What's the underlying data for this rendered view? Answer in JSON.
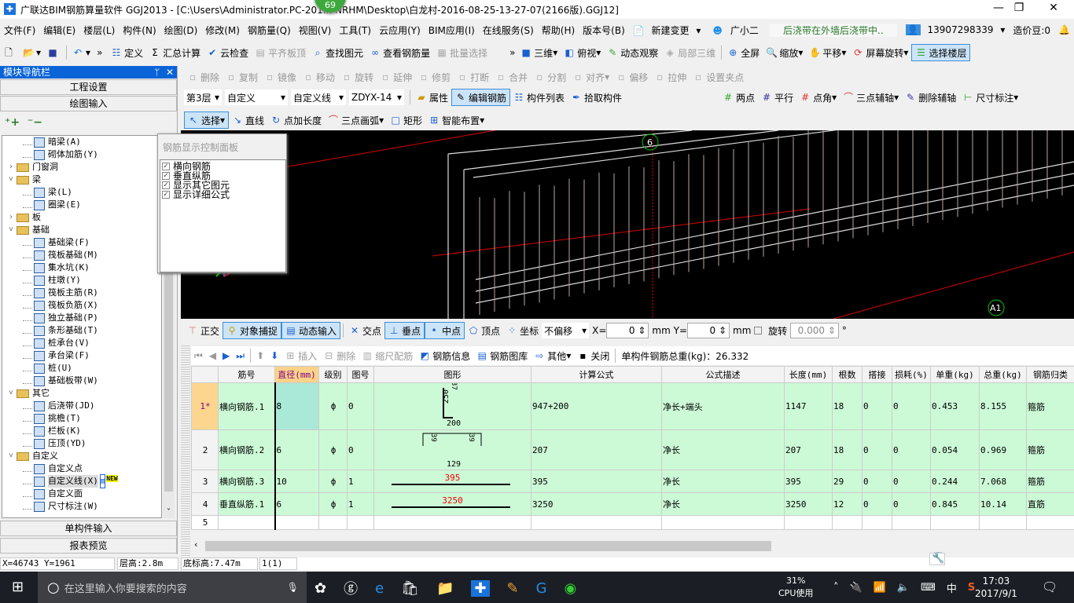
{
  "app": {
    "title": "广联达BIM钢筋算量软件 GGJ2013 - [C:\\Users\\Administrator.PC-201... NRHM\\Desktop\\白龙村-2016-08-25-13-27-07(2166版).GGJ12]",
    "badge": "69"
  },
  "menu": [
    "文件(F)",
    "编辑(E)",
    "楼层(L)",
    "构件(N)",
    "绘图(D)",
    "修改(M)",
    "钢筋量(Q)",
    "视图(V)",
    "工具(T)",
    "云应用(Y)",
    "BIM应用(I)",
    "在线服务(S)",
    "帮助(H)",
    "版本号(B)"
  ],
  "menu_extra": {
    "new_change": "新建变更",
    "assistant": "广小二",
    "notice": "后浇带在外墙后浇带中..",
    "phone": "13907298339",
    "beans": "造价豆:0"
  },
  "toolbar1": {
    "items": [
      "定义",
      "汇总计算",
      "云检查",
      "平齐板顶",
      "查找图元",
      "查看钢筋量",
      "批量选择"
    ],
    "view": [
      "三维",
      "俯视",
      "动态观察",
      "局部三维",
      "全屏",
      "缩放",
      "平移",
      "屏幕旋转",
      "选择楼层"
    ]
  },
  "toolbar2": [
    "删除",
    "复制",
    "镜像",
    "移动",
    "旋转",
    "延伸",
    "修剪",
    "打断",
    "合并",
    "分割",
    "对齐",
    "偏移",
    "拉伸",
    "设置夹点"
  ],
  "toolbar3": {
    "floor": "第3层",
    "type": "自定义",
    "subtype": "自定义线",
    "name": "ZDYX-14",
    "items": [
      "属性",
      "编辑钢筋",
      "构件列表",
      "拾取构件"
    ],
    "axis": [
      "两点",
      "平行",
      "点角",
      "三点辅轴",
      "删除辅轴",
      "尺寸标注"
    ]
  },
  "toolbar4": [
    "选择",
    "直线",
    "点加长度",
    "三点画弧",
    "矩形",
    "智能布置"
  ],
  "nav": {
    "title": "模块导航栏",
    "top_buttons": [
      "工程设置",
      "绘图输入"
    ],
    "bottom_buttons": [
      "单构件输入",
      "报表预览"
    ],
    "tree": [
      {
        "l": 2,
        "t": "暗梁(A)"
      },
      {
        "l": 2,
        "t": "砌体加筋(Y)"
      },
      {
        "l": 1,
        "t": "门窗洞",
        "f": "closed"
      },
      {
        "l": 1,
        "t": "梁",
        "f": "open"
      },
      {
        "l": 2,
        "t": "梁(L)"
      },
      {
        "l": 2,
        "t": "圈梁(E)"
      },
      {
        "l": 1,
        "t": "板",
        "f": "closed"
      },
      {
        "l": 1,
        "t": "基础",
        "f": "open"
      },
      {
        "l": 2,
        "t": "基础梁(F)"
      },
      {
        "l": 2,
        "t": "筏板基础(M)"
      },
      {
        "l": 2,
        "t": "集水坑(K)"
      },
      {
        "l": 2,
        "t": "柱墩(Y)"
      },
      {
        "l": 2,
        "t": "筏板主筋(R)"
      },
      {
        "l": 2,
        "t": "筏板负筋(X)"
      },
      {
        "l": 2,
        "t": "独立基础(P)"
      },
      {
        "l": 2,
        "t": "条形基础(T)"
      },
      {
        "l": 2,
        "t": "桩承台(V)"
      },
      {
        "l": 2,
        "t": "承台梁(F)"
      },
      {
        "l": 2,
        "t": "桩(U)"
      },
      {
        "l": 2,
        "t": "基础板带(W)"
      },
      {
        "l": 1,
        "t": "其它",
        "f": "open"
      },
      {
        "l": 2,
        "t": "后浇带(JD)"
      },
      {
        "l": 2,
        "t": "挑檐(T)"
      },
      {
        "l": 2,
        "t": "栏板(K)"
      },
      {
        "l": 2,
        "t": "压顶(YD)"
      },
      {
        "l": 1,
        "t": "自定义",
        "f": "open"
      },
      {
        "l": 2,
        "t": "自定义点"
      },
      {
        "l": 2,
        "t": "自定义线(X)",
        "sel": true,
        "new": "NEW"
      },
      {
        "l": 2,
        "t": "自定义面"
      },
      {
        "l": 2,
        "t": "尺寸标注(W)"
      }
    ]
  },
  "popup": {
    "title": "钢筋显示控制面板",
    "options": [
      {
        "label": "横向钢筋",
        "checked": true
      },
      {
        "label": "垂直纵筋",
        "checked": true
      },
      {
        "label": "显示其它图元",
        "checked": true
      },
      {
        "label": "显示详细公式",
        "checked": true
      }
    ]
  },
  "viewport": {
    "axis_labels": [
      "6",
      "A1"
    ]
  },
  "snap": {
    "items": [
      "正交",
      "对象捕捉",
      "动态输入",
      "交点",
      "垂点",
      "中点",
      "顶点",
      "坐标"
    ],
    "offset": "不偏移",
    "x_label": "X=",
    "x": "0",
    "y_label": "Y=",
    "y": "0",
    "unit": "mm",
    "rotate": "旋转",
    "angle": "0.000",
    "deg": "°"
  },
  "rebar_toolbar": {
    "items": [
      "插入",
      "删除",
      "缩尺配筋",
      "钢筋信息",
      "钢筋图库",
      "其他",
      "关闭"
    ],
    "total": "单构件钢筋总重(kg)：26.332"
  },
  "grid": {
    "headers": [
      "",
      "筋号",
      "直径(mm)",
      "级别",
      "图号",
      "图形",
      "计算公式",
      "公式描述",
      "长度(mm)",
      "根数",
      "搭接",
      "损耗(%)",
      "单重(kg)",
      "总重(kg)",
      "钢筋归类"
    ],
    "rows": [
      {
        "no": "1*",
        "name": "横向钢筋.1",
        "dia": "8",
        "grade": "ф",
        "fig": "0",
        "shape": [
          "37",
          "250",
          "200"
        ],
        "formula": "947+200",
        "desc": "净长+端头",
        "len": "1147",
        "count": "18",
        "lap": "0",
        "loss": "0",
        "unit_w": "0.453",
        "total_w": "8.155",
        "cat": "箍筋"
      },
      {
        "no": "2",
        "name": "横向钢筋.2",
        "dia": "6",
        "grade": "ф",
        "fig": "0",
        "shape": [
          "39",
          "39",
          "129"
        ],
        "formula": "207",
        "desc": "净长",
        "len": "207",
        "count": "18",
        "lap": "0",
        "loss": "0",
        "unit_w": "0.054",
        "total_w": "0.969",
        "cat": "箍筋"
      },
      {
        "no": "3",
        "name": "横向钢筋.3",
        "dia": "10",
        "grade": "ф",
        "fig": "1",
        "shape": [
          "395"
        ],
        "formula": "395",
        "desc": "净长",
        "len": "395",
        "count": "29",
        "lap": "0",
        "loss": "0",
        "unit_w": "0.244",
        "total_w": "7.068",
        "cat": "箍筋"
      },
      {
        "no": "4",
        "name": "垂直纵筋.1",
        "dia": "6",
        "grade": "ф",
        "fig": "1",
        "shape": [
          "3250"
        ],
        "formula": "3250",
        "desc": "净长",
        "len": "3250",
        "count": "12",
        "lap": "0",
        "loss": "0",
        "unit_w": "0.845",
        "total_w": "10.14",
        "cat": "直筋"
      },
      {
        "no": "5"
      }
    ]
  },
  "status": {
    "coords": "X=46743 Y=1961",
    "floor_h": "层高:2.8m",
    "base_h": "底标高:7.47m",
    "count": "1(1)",
    "ime": "英"
  },
  "taskbar": {
    "search": "在这里输入你要搜索的内容",
    "cpu": "31%",
    "cpu_label": "CPU使用",
    "ime": "中",
    "time": "17:03",
    "date": "2017/9/1"
  },
  "colors": {
    "accent": "#0a64d8",
    "grid_row": "#ccfad6",
    "current_row": "#fcd58e",
    "viewport": "#000000"
  }
}
